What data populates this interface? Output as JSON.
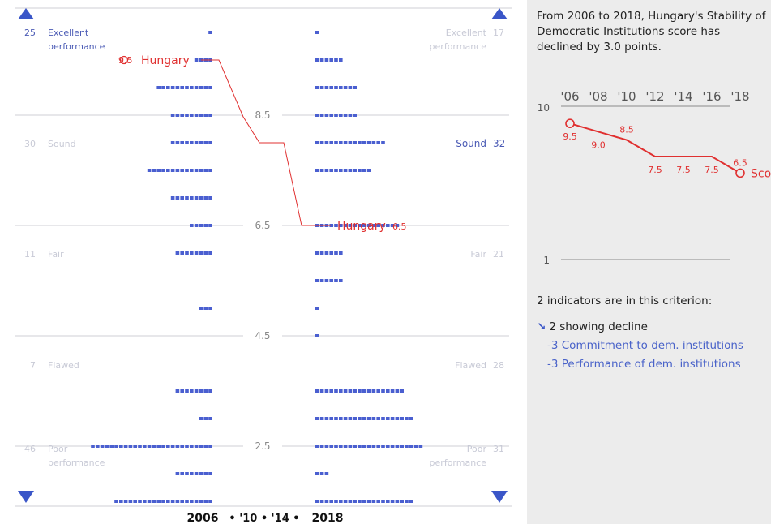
{
  "summary": "From 2006 to 2018, Hungary's Stability of Democratic Institutions score has declined by 3.0 points.",
  "indicators_count_text": "2  indicators are in this criterion:",
  "decline_text": "2 showing decline",
  "indicators": [
    "-3 Commitment to dem. institutions",
    "-3 Performance of dem. institutions"
  ],
  "bottom_axis": {
    "left_year": "2006",
    "middle": "• '10 • '14 •",
    "right_year": "2018"
  },
  "colors": {
    "accent": "#e03030",
    "bar": "#4a5fd0",
    "faint_text": "#c8cad6",
    "label_blue": "#4b5bb5",
    "panel": "#ececec"
  },
  "chart_data": [
    {
      "type": "bar",
      "ylim": [
        1,
        10
      ],
      "y_ticks": [
        "8.5",
        "6.5",
        "4.5",
        "2.5"
      ],
      "categories_2006": [
        {
          "count": "25",
          "name": "Excellent performance"
        },
        {
          "count": "30",
          "name": "Sound"
        },
        {
          "count": "11",
          "name": "Fair"
        },
        {
          "count": "7",
          "name": "Flawed"
        },
        {
          "count": "46",
          "name": "Poor performance"
        }
      ],
      "categories_2018": [
        {
          "count": "17",
          "name": "Excellent performance"
        },
        {
          "count": "32",
          "name": "Sound"
        },
        {
          "count": "21",
          "name": "Fair"
        },
        {
          "count": "28",
          "name": "Flawed"
        },
        {
          "count": "31",
          "name": "Poor performance"
        }
      ],
      "score_levels": [
        10,
        9.5,
        9,
        8.5,
        8,
        7.5,
        7,
        6.5,
        6,
        5.5,
        5,
        4.5,
        4,
        3.5,
        3,
        2.5,
        2,
        1.5,
        1
      ],
      "counts_2006": [
        1,
        4,
        12,
        9,
        9,
        14,
        9,
        5,
        8,
        0,
        3,
        0,
        0,
        8,
        3,
        26,
        8,
        21,
        0
      ],
      "counts_2018": [
        1,
        6,
        9,
        9,
        15,
        12,
        0,
        18,
        6,
        6,
        1,
        1,
        0,
        19,
        21,
        23,
        3,
        21,
        0
      ],
      "highlight": {
        "label": "Hungary",
        "start": 9.5,
        "end": 6.5
      }
    },
    {
      "type": "line",
      "x": [
        "'06",
        "'08",
        "'10",
        "'12",
        "'14",
        "'16",
        "'18"
      ],
      "series": [
        {
          "name": "Score",
          "values": [
            9.5,
            9.0,
            8.5,
            7.5,
            7.5,
            7.5,
            6.5
          ]
        }
      ],
      "ylim": [
        1,
        10
      ],
      "y_ticks": [
        "10",
        "1"
      ]
    }
  ]
}
